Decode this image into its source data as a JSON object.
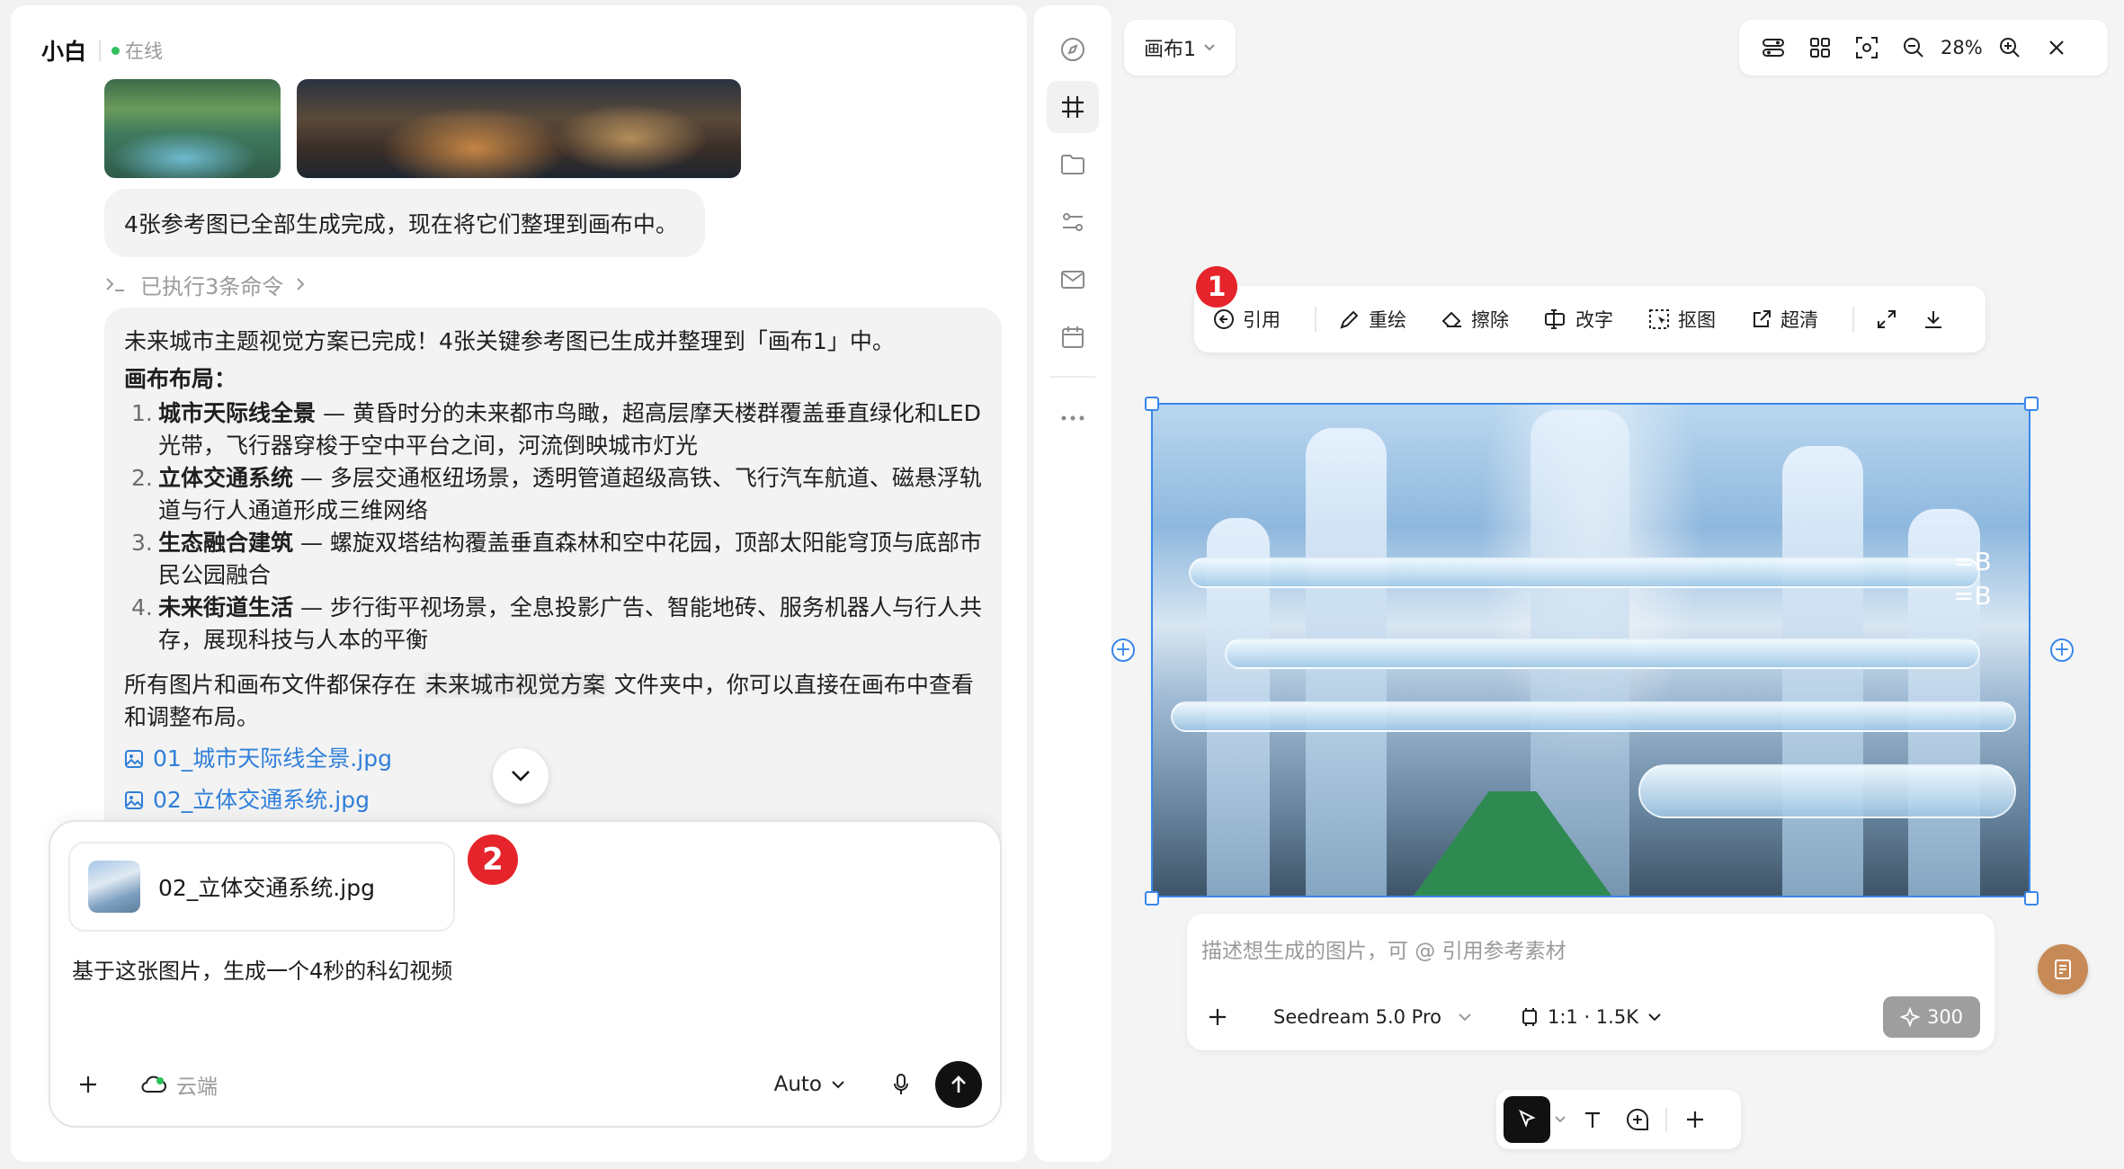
{
  "chat": {
    "agent_name": "小白",
    "status": "在线",
    "status_color": "#2fbf5b",
    "msg_done": "4张参考图已全部生成完成，现在将它们整理到画布中。",
    "executed": "已执行3条命令",
    "summary_intro": "未来城市主题视觉方案已完成！4张关键参考图已生成并整理到「画布1」中。",
    "layout_title": "画布布局：",
    "items": [
      {
        "num": "1.",
        "title": "城市天际线全景",
        "desc": " — 黄昏时分的未来都市鸟瞰，超高层摩天楼群覆盖垂直绿化和LED光带，飞行器穿梭于空中平台之间，河流倒映城市灯光"
      },
      {
        "num": "2.",
        "title": "立体交通系统",
        "desc": " — 多层交通枢纽场景，透明管道超级高铁、飞行汽车航道、磁悬浮轨道与行人通道形成三维网络"
      },
      {
        "num": "3.",
        "title": "生态融合建筑",
        "desc": " — 螺旋双塔结构覆盖垂直森林和空中花园，顶部太阳能穹顶与底部市民公园融合"
      },
      {
        "num": "4.",
        "title": "未来街道生活",
        "desc": " — 步行街平视场景，全息投影广告、智能地砖、服务机器人与行人共存，展现科技与人本的平衡"
      }
    ],
    "saved_pre": "所有图片和画布文件都保存在 ",
    "saved_folder": "未来城市视觉方案",
    "saved_post": " 文件夹中，你可以直接在画布中查看和调整布局。",
    "file_links": [
      "01_城市天际线全景.jpg",
      "02_立体交通系统.jpg"
    ],
    "link_color": "#2f7fd8"
  },
  "composer": {
    "attachment_name": "02_立体交通系统.jpg",
    "badge": "2",
    "text": "基于这张图片，生成一个4秒的科幻视频",
    "cloud_label": "云端",
    "model": "Auto"
  },
  "rail": {
    "icons": [
      "compass-icon",
      "grid-hash-icon",
      "folder-icon",
      "settings-sliders-icon",
      "mail-icon",
      "calendar-icon",
      "more-icon"
    ],
    "active": "grid-hash-icon"
  },
  "canvas": {
    "title": "画布1",
    "zoom": "28%",
    "toolbar_badge": "1",
    "image_tools": [
      "引用",
      "重绘",
      "擦除",
      "改字",
      "抠图",
      "超清"
    ],
    "hero_signs": [
      "=B",
      "=B"
    ],
    "prompt_placeholder": "描述想生成的图片，可 @ 引用参考素材",
    "model": "Seedream 5.0 Pro",
    "ratio": "1:1 · 1.5K",
    "credits": "300",
    "accent": "#3a86e8",
    "badge_color": "#e5242b"
  }
}
